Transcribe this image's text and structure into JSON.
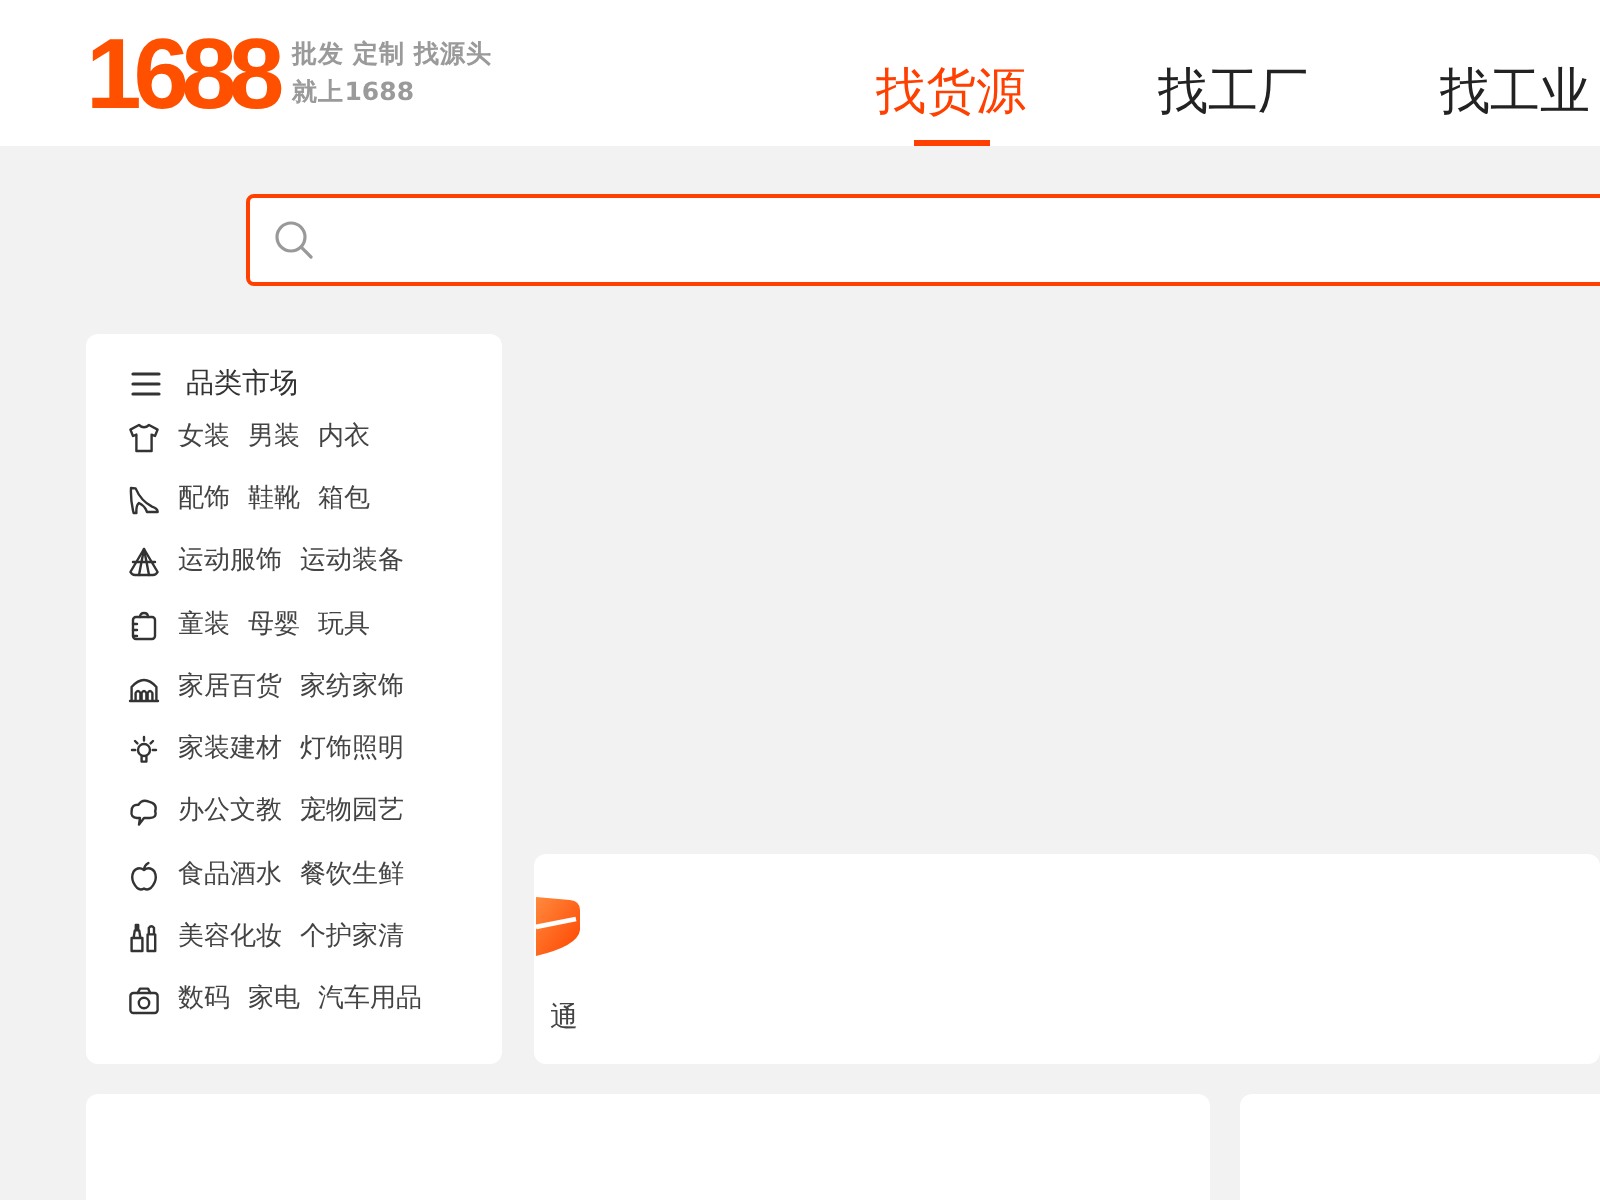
{
  "header": {
    "logo": "1688",
    "tagline": [
      "批发 定制 找源头",
      "就上1688"
    ],
    "tabs": [
      {
        "label": "找货源",
        "selected": true
      },
      {
        "label": "找工厂",
        "selected": false
      },
      {
        "label": "找工业",
        "selected": false
      }
    ]
  },
  "categories": {
    "title": "品类市场",
    "rows": [
      {
        "kind": "shirt",
        "links": [
          "女装",
          "男装",
          "内衣"
        ]
      },
      {
        "kind": "heel",
        "links": [
          "配饰",
          "鞋靴",
          "箱包"
        ]
      },
      {
        "kind": "tent",
        "links": [
          "运动服饰",
          "运动装备"
        ]
      },
      {
        "kind": "notebook",
        "links": [
          "童装",
          "母婴",
          "玩具"
        ]
      },
      {
        "kind": "arches",
        "links": [
          "家居百货",
          "家纺家饰"
        ]
      },
      {
        "kind": "bulb",
        "links": [
          "家装建材",
          "灯饰照明"
        ]
      },
      {
        "kind": "cloud",
        "links": [
          "办公文教",
          "宠物园艺"
        ]
      },
      {
        "kind": "apple",
        "links": [
          "食品酒水",
          "餐饮生鲜"
        ]
      },
      {
        "kind": "bottles",
        "links": [
          "美容化妆",
          "个护家清"
        ]
      },
      {
        "kind": "camera",
        "links": [
          "数码",
          "家电",
          "汽车用品"
        ]
      }
    ]
  },
  "feature_card": {
    "label": "通"
  }
}
